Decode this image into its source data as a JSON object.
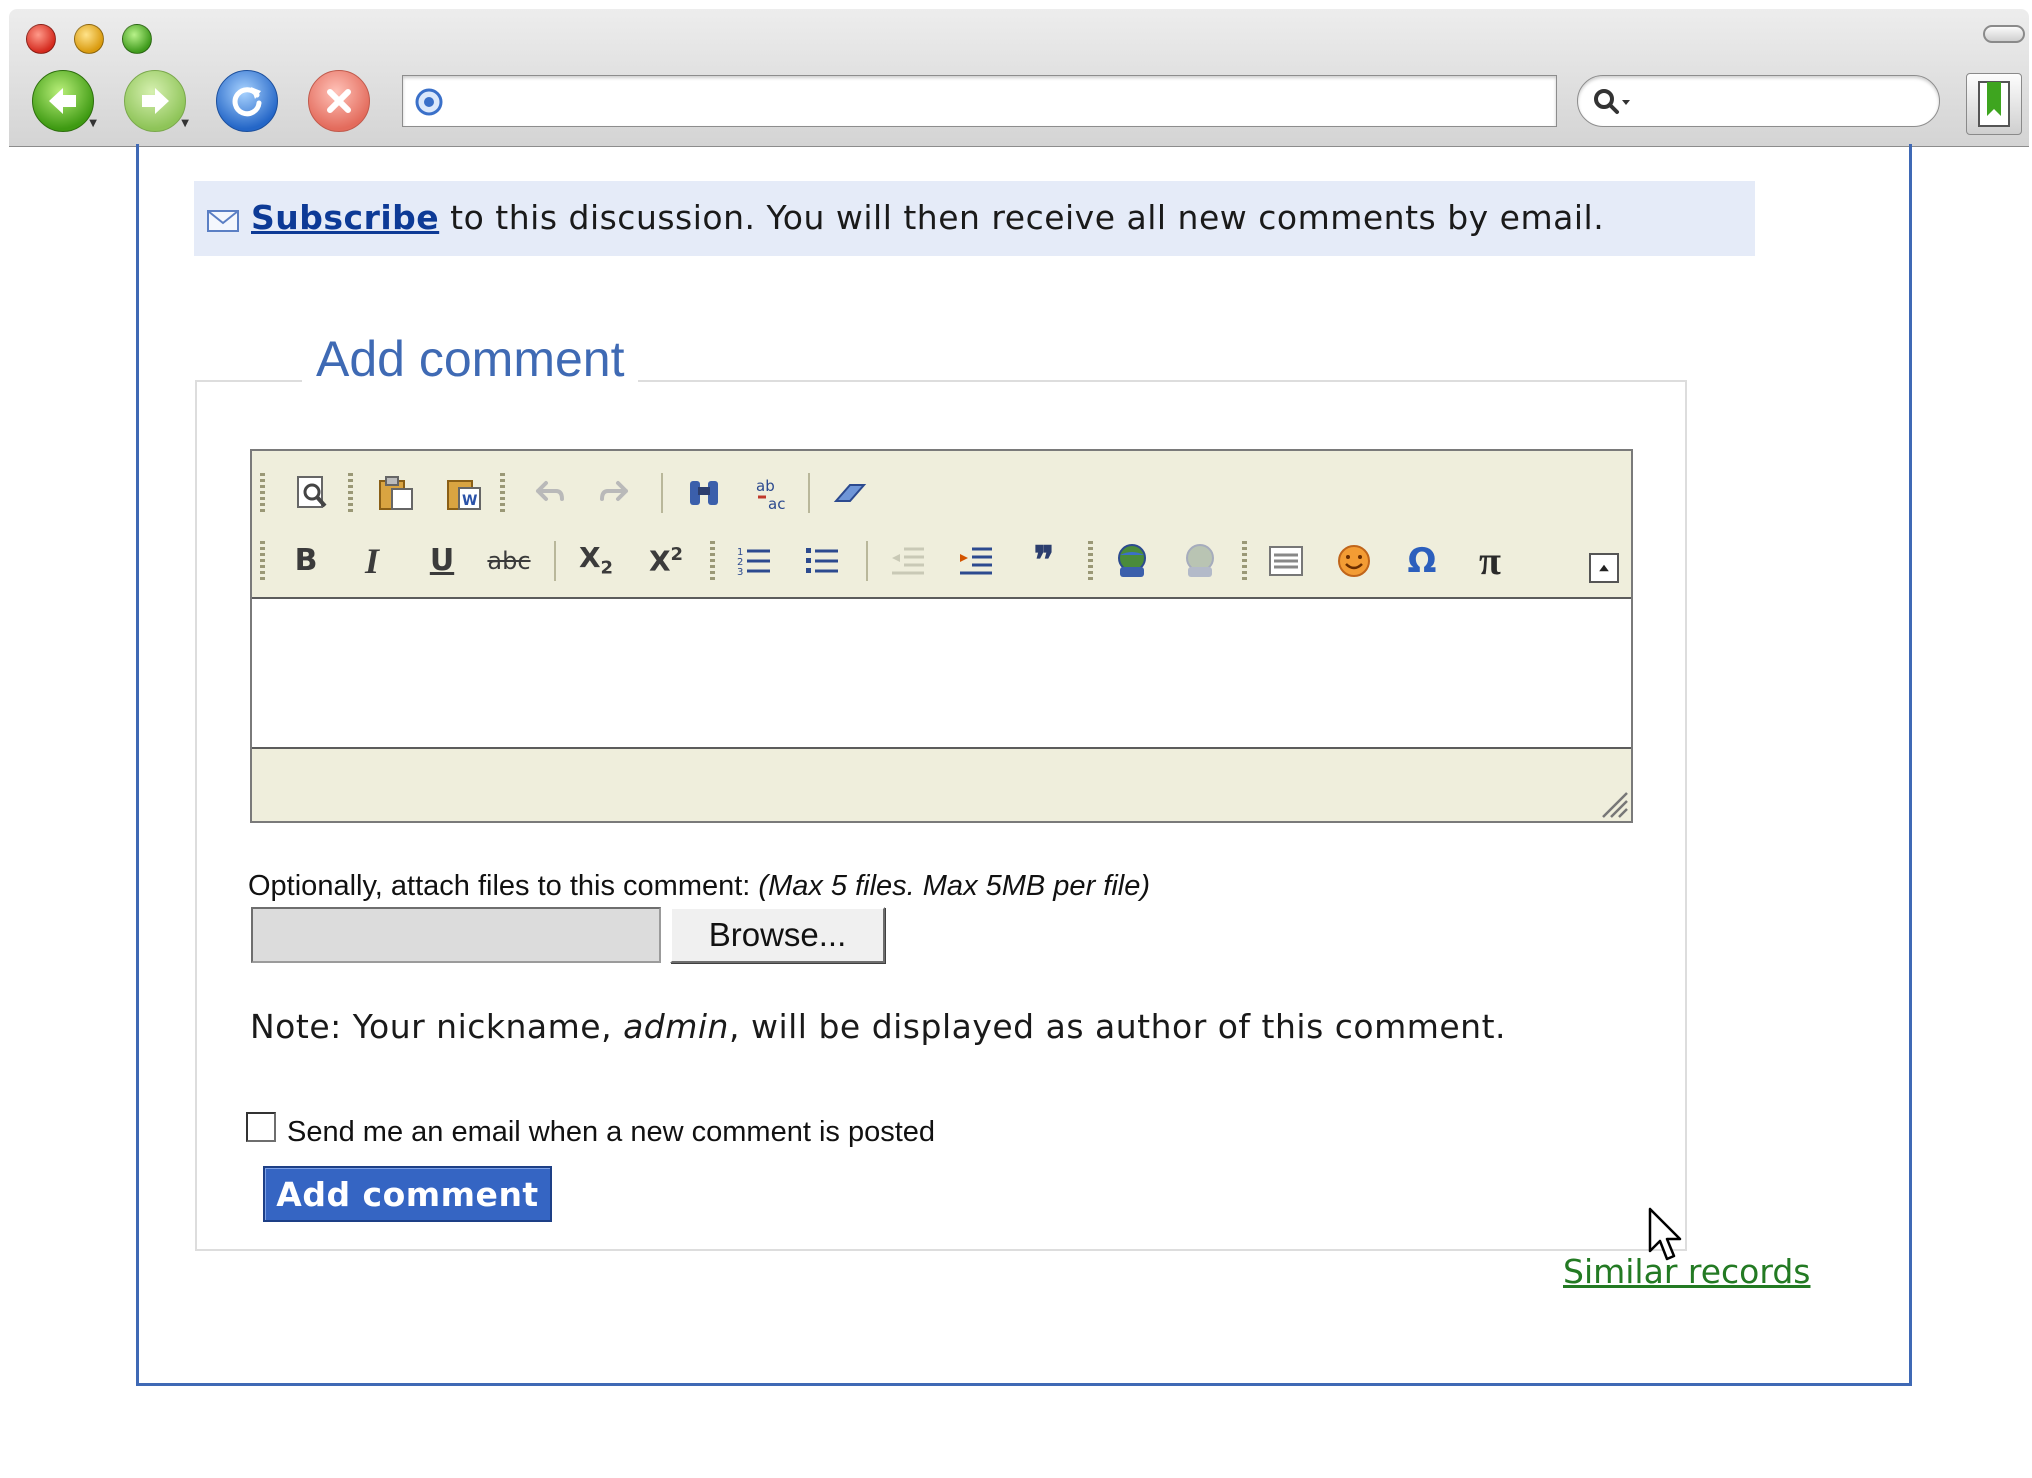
{
  "browser": {
    "url": "",
    "search": "",
    "window_controls": [
      "close-icon",
      "minimize-icon",
      "maximize-icon"
    ],
    "nav_icons": [
      "back-arrow-icon",
      "forward-arrow-icon",
      "reload-icon",
      "stop-icon"
    ],
    "bookmark_icon": "bookmark-icon"
  },
  "subscribe": {
    "icon": "mail-icon",
    "link": "Subscribe",
    "text": " to this discussion. You will then receive all new comments by email."
  },
  "comment_form": {
    "legend": "Add comment",
    "toolbar": {
      "row1": [
        "preview",
        "paste",
        "paste-from-word",
        "undo",
        "redo",
        "find",
        "replace",
        "remove-format"
      ],
      "row2": [
        "bold",
        "italic",
        "underline",
        "strikethrough",
        "subscript",
        "superscript",
        "numbered-list",
        "bulleted-list",
        "outdent",
        "indent",
        "blockquote",
        "link",
        "unlink",
        "horizontal-rule",
        "smiley",
        "special-char",
        "math"
      ],
      "labels": {
        "bold": "B",
        "italic": "I",
        "underline": "U",
        "strike": "abc",
        "sub": "X",
        "sub_idx": "2",
        "sup": "X",
        "sup_idx": "2",
        "quote": "❞",
        "omega": "Ω",
        "pi": "π"
      }
    },
    "attach": {
      "label": "Optionally, attach files to this comment: ",
      "note": "(Max 5 files. Max 5MB per file)",
      "file_value": "",
      "browse": "Browse..."
    },
    "nickname": {
      "prefix": "Note: Your nickname, ",
      "name": "admin",
      "suffix": ", will be displayed as author of this comment."
    },
    "notify": {
      "checked": false,
      "label": "Send me an email when a new comment is posted"
    },
    "submit": "Add comment"
  },
  "similar_records": "Similar records",
  "colors": {
    "accent": "#3f69b5",
    "subscribe_bg": "#e5ebf8",
    "link_blue": "#0d3a96",
    "link_green": "#237a23",
    "editor_bg": "#efeedc"
  }
}
